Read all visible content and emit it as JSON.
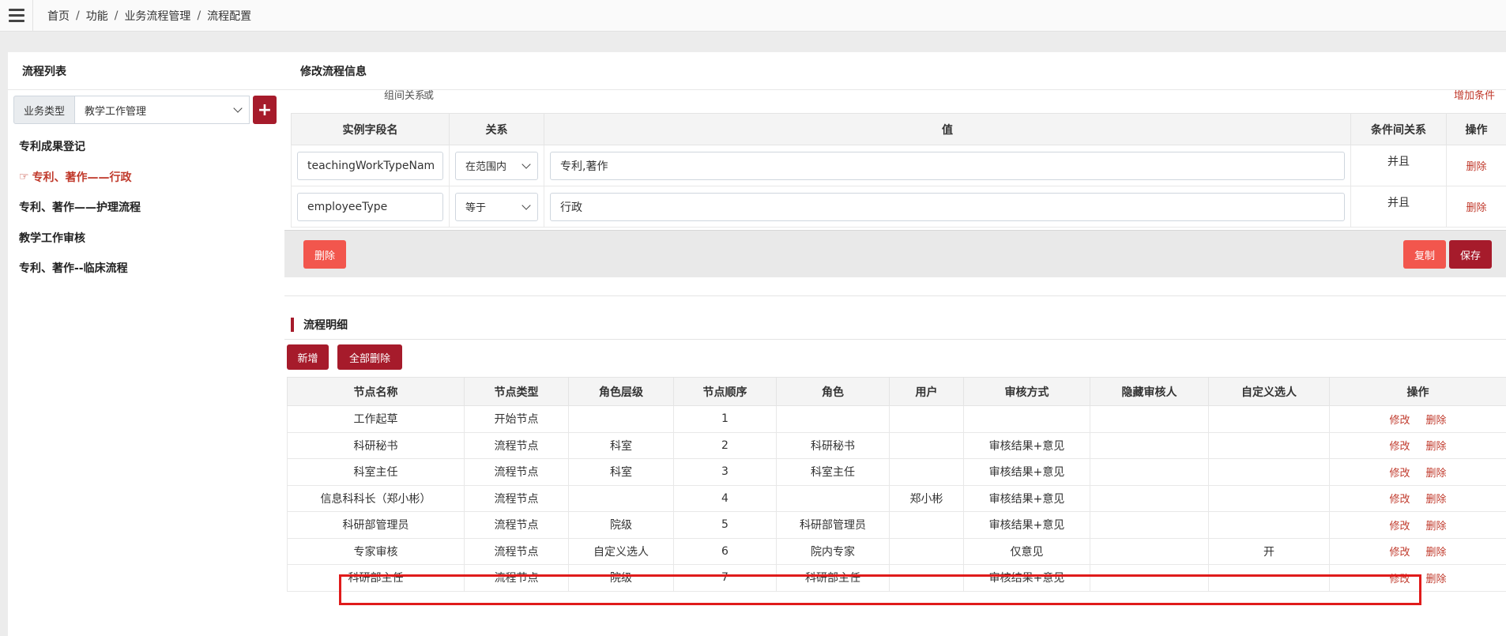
{
  "breadcrumb": [
    "首页",
    "功能",
    "业务流程管理",
    "流程配置"
  ],
  "left": {
    "title": "流程列表",
    "filter_label": "业务类型",
    "filter_value": "教学工作管理",
    "add_label": "+",
    "items": [
      {
        "label": "专利成果登记",
        "active": false
      },
      {
        "label": "专利、著作——行政",
        "active": true
      },
      {
        "label": "专利、著作——护理流程",
        "active": false
      },
      {
        "label": "教学工作审核",
        "active": false
      },
      {
        "label": "专利、著作--临床流程",
        "active": false
      }
    ]
  },
  "right": {
    "title": "修改流程信息",
    "peek": {
      "label": "组间关系",
      "value": "或",
      "link": "增加条件"
    },
    "cond_headers": [
      "实例字段名",
      "关系",
      "值",
      "条件间关系",
      "操作"
    ],
    "cond_rows": [
      {
        "field": "teachingWorkTypeNam",
        "relation": "在范围内",
        "value": "专利,著作",
        "logic": "并且",
        "op": "删除"
      },
      {
        "field": "employeeType",
        "relation": "等于",
        "value": "行政",
        "logic": "并且",
        "op": "删除"
      }
    ],
    "actions": {
      "delete": "删除",
      "copy": "复制",
      "save": "保存"
    },
    "detail_title": "流程明细",
    "detail_buttons": {
      "add": "新增",
      "delete_all": "全部删除"
    },
    "detail_headers": [
      "节点名称",
      "节点类型",
      "角色层级",
      "节点顺序",
      "角色",
      "用户",
      "审核方式",
      "隐藏审核人",
      "自定义选人",
      "操作"
    ],
    "detail_rows": [
      {
        "name": "工作起草",
        "type": "开始节点",
        "level": "",
        "order": "1",
        "role": "",
        "user": "",
        "mode": "",
        "hidden": "",
        "custom": ""
      },
      {
        "name": "科研秘书",
        "type": "流程节点",
        "level": "科室",
        "order": "2",
        "role": "科研秘书",
        "user": "",
        "mode": "审核结果+意见",
        "hidden": "",
        "custom": ""
      },
      {
        "name": "科室主任",
        "type": "流程节点",
        "level": "科室",
        "order": "3",
        "role": "科室主任",
        "user": "",
        "mode": "审核结果+意见",
        "hidden": "",
        "custom": ""
      },
      {
        "name": "信息科科长（郑小彬）",
        "type": "流程节点",
        "level": "",
        "order": "4",
        "role": "",
        "user": "郑小彬",
        "mode": "审核结果+意见",
        "hidden": "",
        "custom": ""
      },
      {
        "name": "科研部管理员",
        "type": "流程节点",
        "level": "院级",
        "order": "5",
        "role": "科研部管理员",
        "user": "",
        "mode": "审核结果+意见",
        "hidden": "",
        "custom": ""
      },
      {
        "name": "专家审核",
        "type": "流程节点",
        "level": "自定义选人",
        "order": "6",
        "role": "院内专家",
        "user": "",
        "mode": "仅意见",
        "hidden": "",
        "custom": "开"
      },
      {
        "name": "科研部主任",
        "type": "流程节点",
        "level": "院级",
        "order": "7",
        "role": "科研部主任",
        "user": "",
        "mode": "审核结果+意见",
        "hidden": "",
        "custom": ""
      }
    ],
    "op_edit": "修改",
    "op_delete": "删除"
  }
}
